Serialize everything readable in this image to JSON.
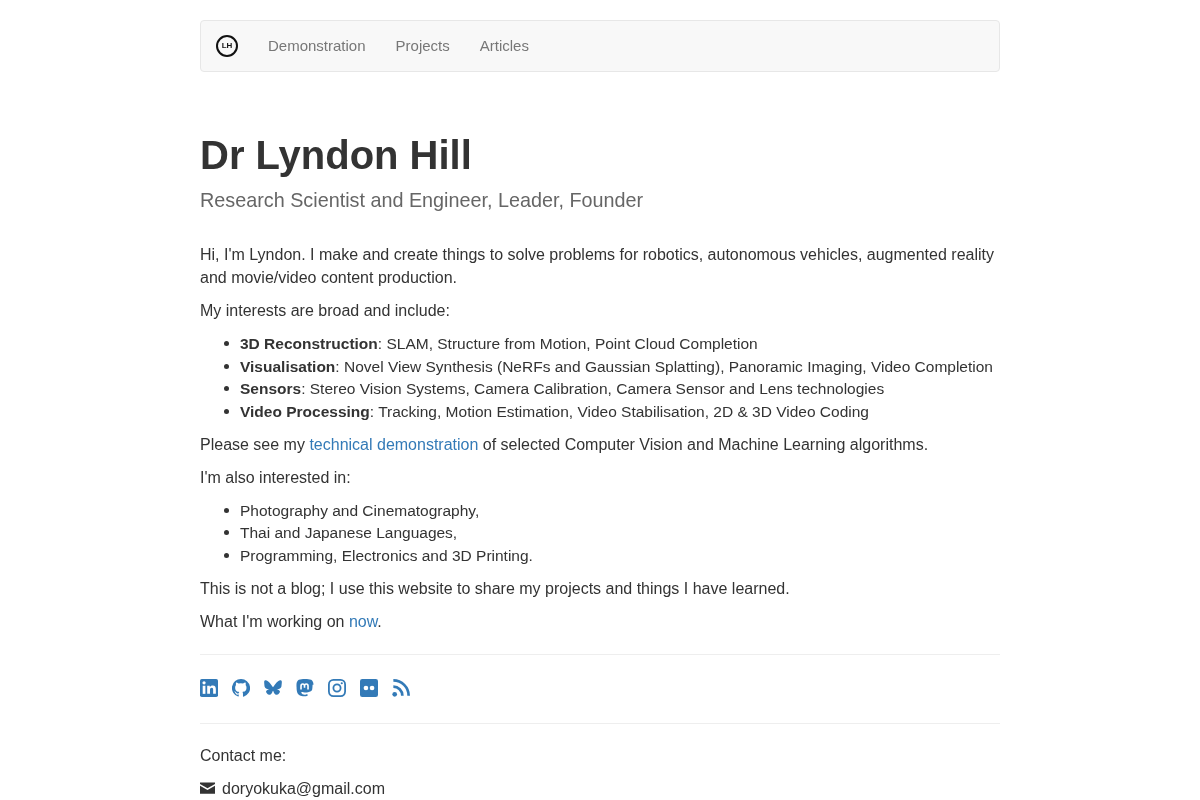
{
  "nav": {
    "logo": "LH",
    "links": [
      {
        "label": "Demonstration"
      },
      {
        "label": "Projects"
      },
      {
        "label": "Articles"
      }
    ]
  },
  "header": {
    "title": "Dr Lyndon Hill",
    "subtitle": "Research Scientist and Engineer, Leader, Founder"
  },
  "body": [
    {
      "kind": "paragraph",
      "parts": [
        {
          "kind": "text",
          "text": "Hi, I'm Lyndon. I make and create things to solve problems for robotics, autonomous vehicles, augmented reality and movie/video content production."
        }
      ]
    },
    {
      "kind": "paragraph",
      "parts": [
        {
          "kind": "text",
          "text": "My interests are broad and include:"
        }
      ]
    },
    {
      "kind": "list",
      "items": [
        "**3D Reconstruction**: SLAM, Structure from Motion, Point Cloud Completion",
        "**Visualisation**: Novel View Synthesis (NeRFs and Gaussian Splatting), Panoramic Imaging, Video Completion",
        "**Sensors**: Stereo Vision Systems, Camera Calibration, Camera Sensor and Lens technologies",
        "**Video Processing**: Tracking, Motion Estimation, Video Stabilisation, 2D & 3D Video Coding"
      ]
    },
    {
      "kind": "paragraph",
      "parts": [
        {
          "kind": "text",
          "text": "Please see my "
        },
        {
          "kind": "link",
          "text": "technical demonstration"
        },
        {
          "kind": "text",
          "text": " of selected Computer Vision and Machine Learning algorithms."
        }
      ]
    },
    {
      "kind": "paragraph",
      "parts": [
        {
          "kind": "text",
          "text": "I'm also interested in:"
        }
      ]
    },
    {
      "kind": "list",
      "items": [
        "Photography and Cinematography,",
        "Thai and Japanese Languages,",
        "Programming, Electronics and 3D Printing."
      ]
    },
    {
      "kind": "paragraph",
      "parts": [
        {
          "kind": "text",
          "text": "This is not a blog; I use this website to share my projects and things I have learned."
        }
      ]
    },
    {
      "kind": "paragraph",
      "parts": [
        {
          "kind": "text",
          "text": "What I'm working on "
        },
        {
          "kind": "link",
          "text": "now"
        },
        {
          "kind": "text",
          "text": "."
        }
      ]
    }
  ],
  "contact": {
    "heading": "Contact me:",
    "email": "doryokuka@gmail.com"
  }
}
